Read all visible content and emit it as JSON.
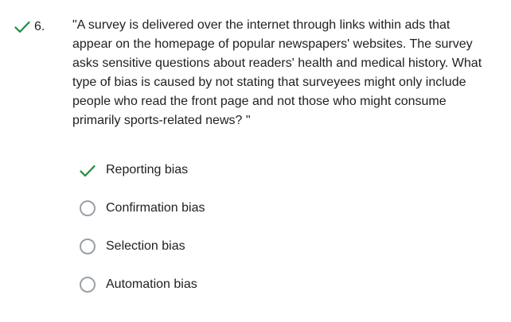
{
  "colors": {
    "correct": "#1e8e3e",
    "text": "#202124",
    "radio_border": "#9aa0a6"
  },
  "question": {
    "status_icon": "checkmark-icon",
    "number": "6.",
    "text": "\"A survey is delivered over the internet through links within ads that appear on the homepage of popular newspapers' websites. The survey asks sensitive questions about readers' health and medical history. What type of bias is caused by not stating that surveyees might only include people who read the front page and not those who might consume primarily sports-related news? \""
  },
  "options": [
    {
      "label": "Reporting bias",
      "state": "selected-correct",
      "icon": "checkmark-icon"
    },
    {
      "label": "Confirmation bias",
      "state": "unselected",
      "icon": "radio-icon"
    },
    {
      "label": "Selection bias",
      "state": "unselected",
      "icon": "radio-icon"
    },
    {
      "label": "Automation bias",
      "state": "unselected",
      "icon": "radio-icon"
    }
  ]
}
